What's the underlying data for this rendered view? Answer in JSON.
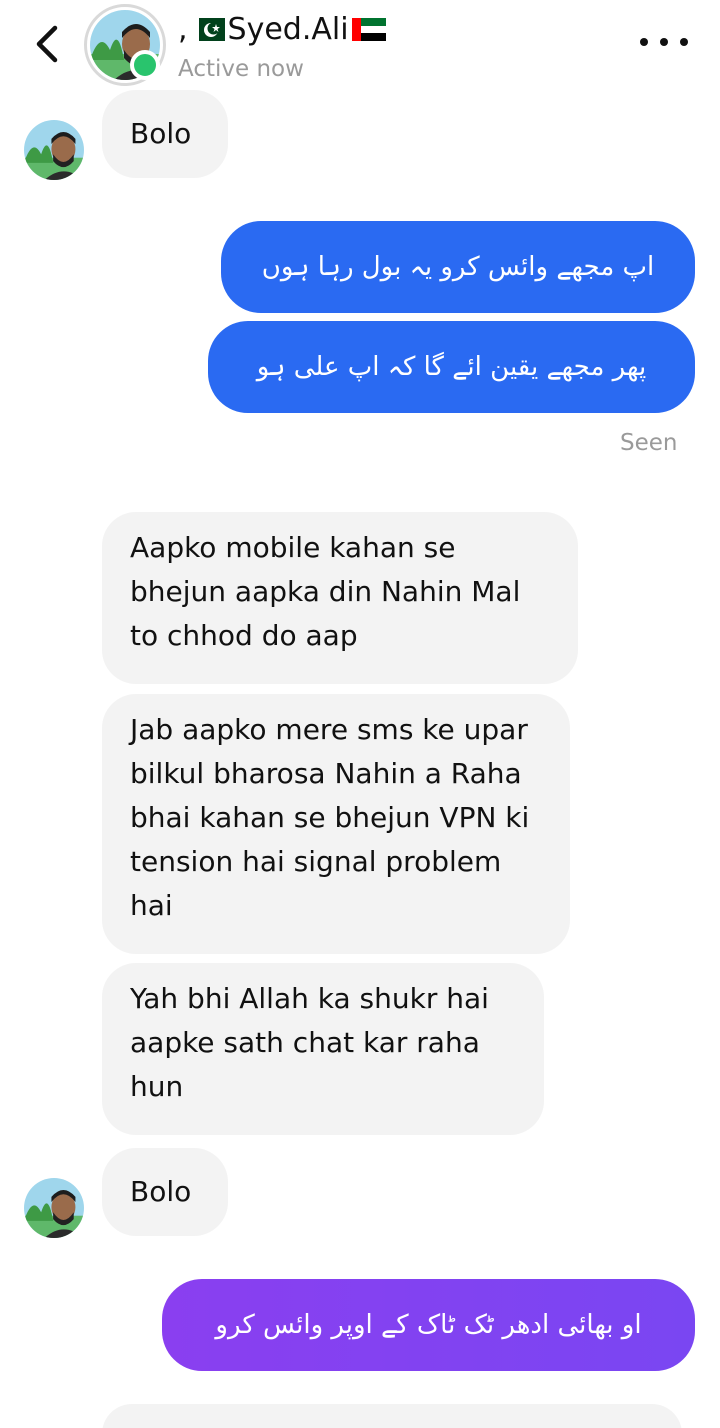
{
  "header": {
    "prefix": ",",
    "contact_name": "Syed.Ali",
    "status": "Active now"
  },
  "colors": {
    "outgoing_blue": "#2a6af2",
    "outgoing_purple": "#8a3ff0",
    "incoming_bg": "#f3f3f3",
    "online_green": "#29c46d"
  },
  "messages": [
    {
      "from": "contact",
      "text": "Bolo"
    },
    {
      "from": "me",
      "text": "اپ مجھے وائس کرو یہ بول رہا ہوں"
    },
    {
      "from": "me",
      "text": "پھر مجھے یقین ائے گا کہ اپ علی ہو"
    },
    {
      "from": "contact",
      "text": "Aapko mobile kahan se bhejun aapka din Nahin Mal to chhod do aap"
    },
    {
      "from": "contact",
      "text": "Jab aapko mere sms ke upar bilkul bharosa Nahin a Raha bhai kahan se bhejun VPN ki tension hai signal problem hai"
    },
    {
      "from": "contact",
      "text": "Yah bhi Allah ka shukr hai aapke sath chat kar raha hun"
    },
    {
      "from": "contact",
      "text": "Bolo"
    },
    {
      "from": "me",
      "text": "او بھائی ادھر ٹک ٹاک کے اوپر وائس کرو"
    }
  ],
  "seen_label": "Seen"
}
